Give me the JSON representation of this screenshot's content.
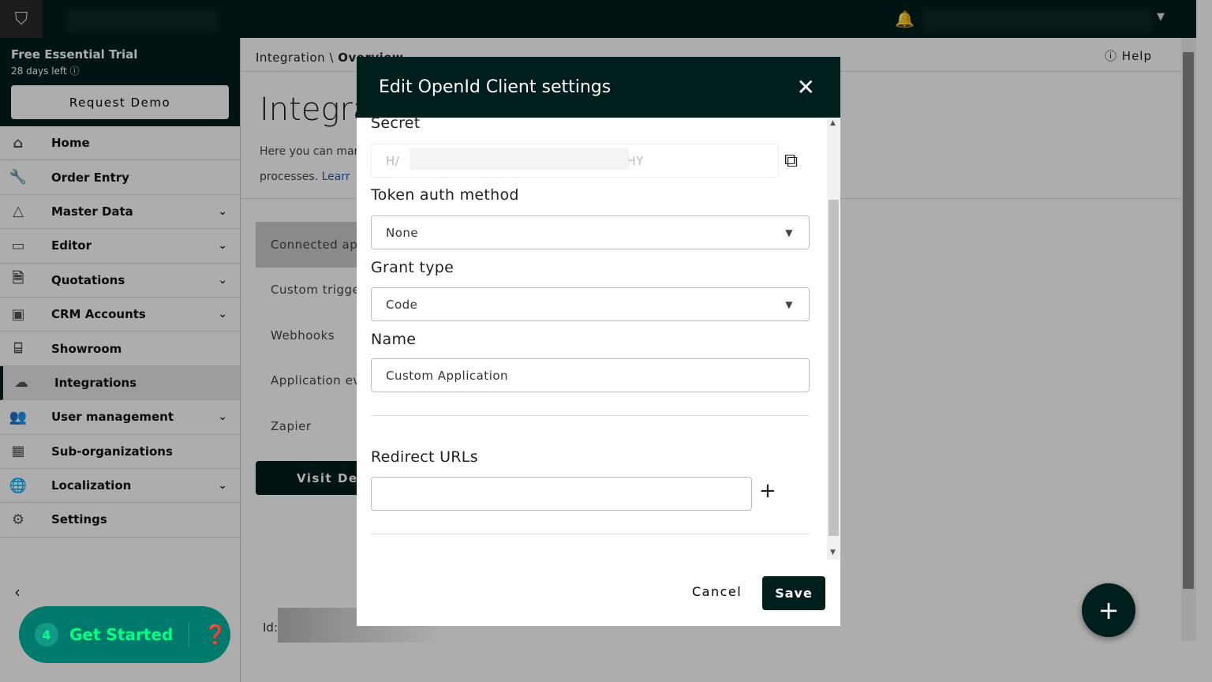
{
  "topbar": {
    "logo_icon": "shield-logo-icon",
    "bell_icon": "bell-icon"
  },
  "trial": {
    "title": "Free Essential Trial",
    "days": "28 days left",
    "request_demo": "Request Demo"
  },
  "sidebar": {
    "items": [
      {
        "label": "Home",
        "icon": "⌂",
        "chevron": false
      },
      {
        "label": "Order Entry",
        "icon": "🔧",
        "chevron": false
      },
      {
        "label": "Master Data",
        "icon": "△",
        "chevron": true
      },
      {
        "label": "Editor",
        "icon": "▭",
        "chevron": true
      },
      {
        "label": "Quotations",
        "icon": "🗎",
        "chevron": true
      },
      {
        "label": "CRM Accounts",
        "icon": "▣",
        "chevron": true
      },
      {
        "label": "Showroom",
        "icon": "⌸",
        "chevron": false
      },
      {
        "label": "Integrations",
        "icon": "☁",
        "chevron": false,
        "active": true
      },
      {
        "label": "User management",
        "icon": "👥",
        "chevron": true
      },
      {
        "label": "Sub-organizations",
        "icon": "▦",
        "chevron": false
      },
      {
        "label": "Localization",
        "icon": "🌐",
        "chevron": true
      },
      {
        "label": "Settings",
        "icon": "⚙",
        "chevron": false
      }
    ]
  },
  "get_started": {
    "count": "4",
    "label": "Get Started"
  },
  "main": {
    "breadcrumb_parent": "Integration",
    "breadcrumb_sep": "\\",
    "breadcrumb_current": "Overview",
    "help": "Help",
    "title": "Integra",
    "desc_line1": "Here you can mar",
    "desc_line2": "processes.",
    "learn": "Learr",
    "tabs": [
      "Connected apr",
      "Custom trigge",
      "Webhooks",
      "Application ev",
      "Zapier"
    ],
    "visit": "Visit Dev",
    "id_label": "Id:"
  },
  "modal": {
    "title": "Edit OpenId Client settings",
    "secret_label": "Secret",
    "secret_start": "H/",
    "secret_end": "HY",
    "token_label": "Token auth method",
    "token_value": "None",
    "grant_label": "Grant type",
    "grant_value": "Code",
    "name_label": "Name",
    "name_value": "Custom Application",
    "redirect_label": "Redirect URLs",
    "redirect_value": "",
    "cancel": "Cancel",
    "save": "Save"
  }
}
